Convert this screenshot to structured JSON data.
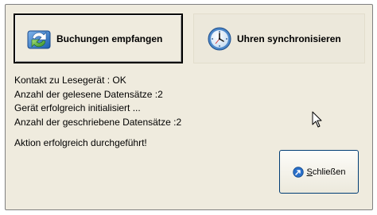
{
  "buttons": {
    "receive_bookings": "Buchungen empfangen",
    "sync_clocks": "Uhren synchronisieren",
    "close_mnemonic": "S",
    "close_rest": "chließen"
  },
  "log": {
    "lines": [
      "Kontakt zu Lesegerät : OK",
      "Anzahl der gelesene Datensätze :2",
      "Gerät erfolgreich initialisiert ...",
      "Anzahl der geschriebene Datensätze :2"
    ],
    "status": "Aktion erfolgreich durchgeführt!"
  },
  "icons": {
    "receive": "sync-arrows-icon",
    "sync": "clock-icon",
    "close": "close-arrow-icon"
  },
  "colors": {
    "dialog_bg": "#efebde",
    "close_border": "#003c74"
  }
}
